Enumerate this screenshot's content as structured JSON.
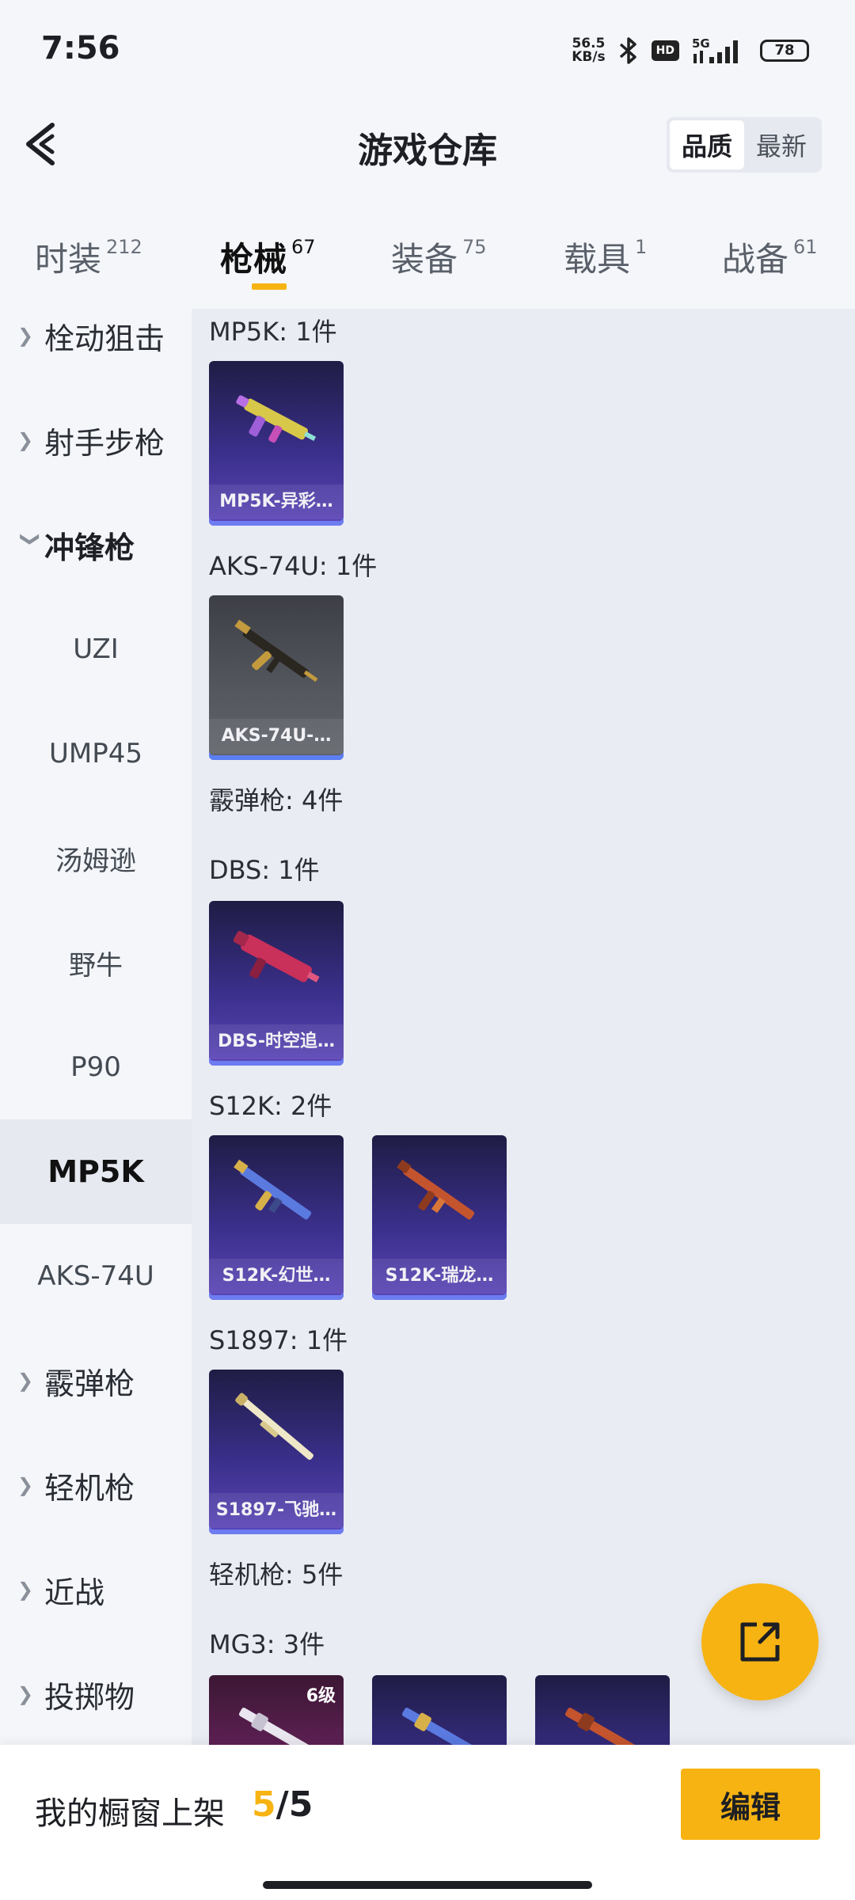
{
  "status": {
    "time": "7:56",
    "net_speed_value": "56.5",
    "net_speed_unit": "KB/s",
    "hd": "HD",
    "network": "5G",
    "battery": "78"
  },
  "header": {
    "title": "游戏仓库",
    "sort_options": [
      "品质",
      "最新"
    ],
    "sort_selected": "品质"
  },
  "tabs": [
    {
      "label": "时装",
      "count": "212"
    },
    {
      "label": "枪械",
      "count": "67"
    },
    {
      "label": "装备",
      "count": "75"
    },
    {
      "label": "载具",
      "count": "1"
    },
    {
      "label": "战备",
      "count": "61"
    }
  ],
  "active_tab": "枪械",
  "sidebar": {
    "items": [
      {
        "label": "栓动狙击",
        "type": "category"
      },
      {
        "label": "射手步枪",
        "type": "category"
      },
      {
        "label": "冲锋枪",
        "type": "category-open"
      },
      {
        "label": "UZI",
        "type": "sub"
      },
      {
        "label": "UMP45",
        "type": "sub"
      },
      {
        "label": "汤姆逊",
        "type": "sub"
      },
      {
        "label": "野牛",
        "type": "sub"
      },
      {
        "label": "P90",
        "type": "sub"
      },
      {
        "label": "MP5K",
        "type": "sub-active"
      },
      {
        "label": "AKS-74U",
        "type": "sub"
      },
      {
        "label": "霰弹枪",
        "type": "category"
      },
      {
        "label": "轻机枪",
        "type": "category"
      },
      {
        "label": "近战",
        "type": "category"
      },
      {
        "label": "投掷物",
        "type": "category"
      }
    ]
  },
  "content": {
    "groups": [
      {
        "heading": "MP5K: 1件",
        "items": [
          {
            "name": "MP5K-异彩…"
          }
        ]
      },
      {
        "heading": "AKS-74U: 1件",
        "items": [
          {
            "name": "AKS-74U-…"
          }
        ]
      },
      {
        "heading": "霰弹枪: 4件"
      },
      {
        "heading": "DBS: 1件",
        "items": [
          {
            "name": "DBS-时空追…"
          }
        ]
      },
      {
        "heading": "S12K: 2件",
        "items": [
          {
            "name": "S12K-幻世…"
          },
          {
            "name": "S12K-瑞龙…"
          }
        ]
      },
      {
        "heading": "S1897: 1件",
        "items": [
          {
            "name": "S1897-飞驰…"
          }
        ]
      },
      {
        "heading": "轻机枪: 5件"
      },
      {
        "heading": "MG3: 3件",
        "items": [
          {
            "level": "6级"
          },
          {},
          {}
        ]
      }
    ]
  },
  "bottom": {
    "shelf_label": "我的橱窗上架",
    "shelf_current": "5",
    "shelf_sep": "/",
    "shelf_total": "5",
    "edit_label": "编辑"
  },
  "colors": {
    "accent": "#f7b312",
    "card_purple": "#3a2f8a",
    "card_grey": "#55585f"
  }
}
